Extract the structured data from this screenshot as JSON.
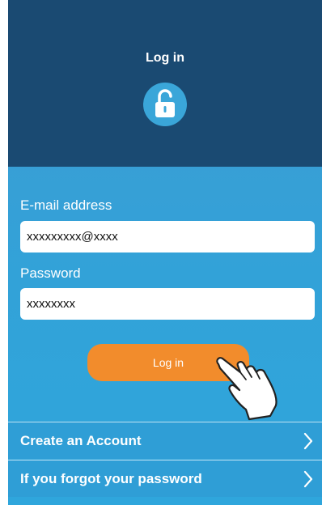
{
  "header": {
    "title": "Log in",
    "icon": "unlock-icon"
  },
  "form": {
    "email_label": "E-mail address",
    "email_value": "xxxxxxxxx@xxxx",
    "password_label": "Password",
    "password_value": "xxxxxxxx"
  },
  "login_button": {
    "label": "Log in",
    "color": "#f28c2c"
  },
  "pointer": {
    "icon": "pointing-hand-icon"
  },
  "menu": {
    "items": [
      {
        "label": "Create an Account",
        "icon": "chevron-right-icon"
      },
      {
        "label": "If you forgot your password",
        "icon": "chevron-right-icon"
      }
    ]
  },
  "colors": {
    "header": "#1a4a72",
    "body": "#3aa1d8",
    "accent": "#f28c2c"
  }
}
